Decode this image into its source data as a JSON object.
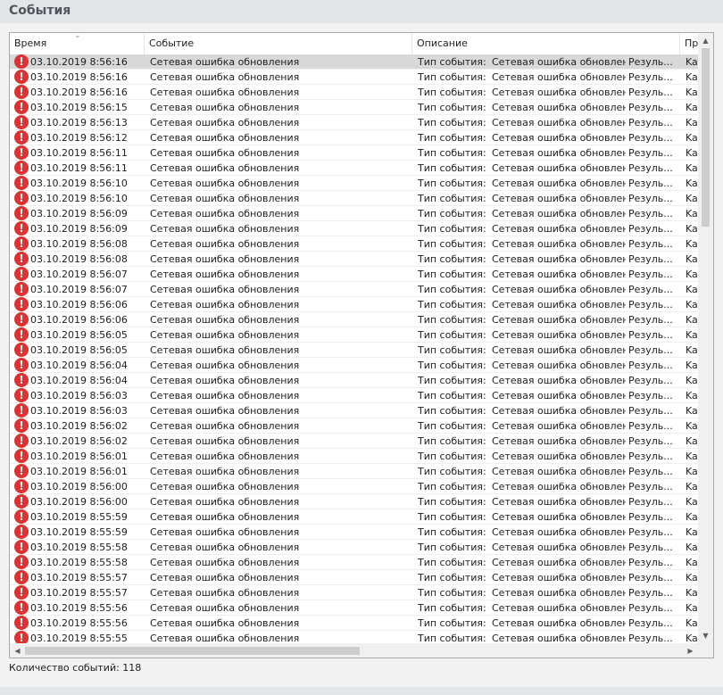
{
  "header": {
    "title": "События"
  },
  "list": {
    "columns": [
      {
        "id": "time",
        "label": "Время"
      },
      {
        "id": "event",
        "label": "Событие"
      },
      {
        "id": "description",
        "label": "Описание"
      },
      {
        "id": "product",
        "label": "Про"
      }
    ],
    "sort_icon": "sort-descending-icon",
    "row_icon": "error-icon",
    "row_icon_color": "#dc3232",
    "selected_row": 0,
    "rows": [
      {
        "time": "03.10.2019 8:56:16",
        "event": "Сетевая ошибка обновления",
        "type_label": "Тип события:",
        "type_value": "Сетевая ошибка обновления",
        "result": "Резуль...",
        "product": "Kas"
      },
      {
        "time": "03.10.2019 8:56:16",
        "event": "Сетевая ошибка обновления",
        "type_label": "Тип события:",
        "type_value": "Сетевая ошибка обновления",
        "result": "Резуль...",
        "product": "Kas"
      },
      {
        "time": "03.10.2019 8:56:16",
        "event": "Сетевая ошибка обновления",
        "type_label": "Тип события:",
        "type_value": "Сетевая ошибка обновления",
        "result": "Резуль...",
        "product": "Kas"
      },
      {
        "time": "03.10.2019 8:56:15",
        "event": "Сетевая ошибка обновления",
        "type_label": "Тип события:",
        "type_value": "Сетевая ошибка обновления",
        "result": "Резуль...",
        "product": "Kas"
      },
      {
        "time": "03.10.2019 8:56:13",
        "event": "Сетевая ошибка обновления",
        "type_label": "Тип события:",
        "type_value": "Сетевая ошибка обновления",
        "result": "Резуль...",
        "product": "Kas"
      },
      {
        "time": "03.10.2019 8:56:12",
        "event": "Сетевая ошибка обновления",
        "type_label": "Тип события:",
        "type_value": "Сетевая ошибка обновления",
        "result": "Резуль...",
        "product": "Kas"
      },
      {
        "time": "03.10.2019 8:56:11",
        "event": "Сетевая ошибка обновления",
        "type_label": "Тип события:",
        "type_value": "Сетевая ошибка обновления",
        "result": "Резуль...",
        "product": "Kas"
      },
      {
        "time": "03.10.2019 8:56:11",
        "event": "Сетевая ошибка обновления",
        "type_label": "Тип события:",
        "type_value": "Сетевая ошибка обновления",
        "result": "Резуль...",
        "product": "Kas"
      },
      {
        "time": "03.10.2019 8:56:10",
        "event": "Сетевая ошибка обновления",
        "type_label": "Тип события:",
        "type_value": "Сетевая ошибка обновления",
        "result": "Резуль...",
        "product": "Kas"
      },
      {
        "time": "03.10.2019 8:56:10",
        "event": "Сетевая ошибка обновления",
        "type_label": "Тип события:",
        "type_value": "Сетевая ошибка обновления",
        "result": "Резуль...",
        "product": "Kas"
      },
      {
        "time": "03.10.2019 8:56:09",
        "event": "Сетевая ошибка обновления",
        "type_label": "Тип события:",
        "type_value": "Сетевая ошибка обновления",
        "result": "Резуль...",
        "product": "Kas"
      },
      {
        "time": "03.10.2019 8:56:09",
        "event": "Сетевая ошибка обновления",
        "type_label": "Тип события:",
        "type_value": "Сетевая ошибка обновления",
        "result": "Резуль...",
        "product": "Kas"
      },
      {
        "time": "03.10.2019 8:56:08",
        "event": "Сетевая ошибка обновления",
        "type_label": "Тип события:",
        "type_value": "Сетевая ошибка обновления",
        "result": "Резуль...",
        "product": "Kas"
      },
      {
        "time": "03.10.2019 8:56:08",
        "event": "Сетевая ошибка обновления",
        "type_label": "Тип события:",
        "type_value": "Сетевая ошибка обновления",
        "result": "Резуль...",
        "product": "Kas"
      },
      {
        "time": "03.10.2019 8:56:07",
        "event": "Сетевая ошибка обновления",
        "type_label": "Тип события:",
        "type_value": "Сетевая ошибка обновления",
        "result": "Резуль...",
        "product": "Kas"
      },
      {
        "time": "03.10.2019 8:56:07",
        "event": "Сетевая ошибка обновления",
        "type_label": "Тип события:",
        "type_value": "Сетевая ошибка обновления",
        "result": "Резуль...",
        "product": "Kas"
      },
      {
        "time": "03.10.2019 8:56:06",
        "event": "Сетевая ошибка обновления",
        "type_label": "Тип события:",
        "type_value": "Сетевая ошибка обновления",
        "result": "Резуль...",
        "product": "Kas"
      },
      {
        "time": "03.10.2019 8:56:06",
        "event": "Сетевая ошибка обновления",
        "type_label": "Тип события:",
        "type_value": "Сетевая ошибка обновления",
        "result": "Резуль...",
        "product": "Kas"
      },
      {
        "time": "03.10.2019 8:56:05",
        "event": "Сетевая ошибка обновления",
        "type_label": "Тип события:",
        "type_value": "Сетевая ошибка обновления",
        "result": "Резуль...",
        "product": "Kas"
      },
      {
        "time": "03.10.2019 8:56:05",
        "event": "Сетевая ошибка обновления",
        "type_label": "Тип события:",
        "type_value": "Сетевая ошибка обновления",
        "result": "Резуль...",
        "product": "Kas"
      },
      {
        "time": "03.10.2019 8:56:04",
        "event": "Сетевая ошибка обновления",
        "type_label": "Тип события:",
        "type_value": "Сетевая ошибка обновления",
        "result": "Резуль...",
        "product": "Kas"
      },
      {
        "time": "03.10.2019 8:56:04",
        "event": "Сетевая ошибка обновления",
        "type_label": "Тип события:",
        "type_value": "Сетевая ошибка обновления",
        "result": "Резуль...",
        "product": "Kas"
      },
      {
        "time": "03.10.2019 8:56:03",
        "event": "Сетевая ошибка обновления",
        "type_label": "Тип события:",
        "type_value": "Сетевая ошибка обновления",
        "result": "Резуль...",
        "product": "Kas"
      },
      {
        "time": "03.10.2019 8:56:03",
        "event": "Сетевая ошибка обновления",
        "type_label": "Тип события:",
        "type_value": "Сетевая ошибка обновления",
        "result": "Резуль...",
        "product": "Kas"
      },
      {
        "time": "03.10.2019 8:56:02",
        "event": "Сетевая ошибка обновления",
        "type_label": "Тип события:",
        "type_value": "Сетевая ошибка обновления",
        "result": "Резуль...",
        "product": "Kas"
      },
      {
        "time": "03.10.2019 8:56:02",
        "event": "Сетевая ошибка обновления",
        "type_label": "Тип события:",
        "type_value": "Сетевая ошибка обновления",
        "result": "Резуль...",
        "product": "Kas"
      },
      {
        "time": "03.10.2019 8:56:01",
        "event": "Сетевая ошибка обновления",
        "type_label": "Тип события:",
        "type_value": "Сетевая ошибка обновления",
        "result": "Резуль...",
        "product": "Kas"
      },
      {
        "time": "03.10.2019 8:56:01",
        "event": "Сетевая ошибка обновления",
        "type_label": "Тип события:",
        "type_value": "Сетевая ошибка обновления",
        "result": "Резуль...",
        "product": "Kas"
      },
      {
        "time": "03.10.2019 8:56:00",
        "event": "Сетевая ошибка обновления",
        "type_label": "Тип события:",
        "type_value": "Сетевая ошибка обновления",
        "result": "Резуль...",
        "product": "Kas"
      },
      {
        "time": "03.10.2019 8:56:00",
        "event": "Сетевая ошибка обновления",
        "type_label": "Тип события:",
        "type_value": "Сетевая ошибка обновления",
        "result": "Резуль...",
        "product": "Kas"
      },
      {
        "time": "03.10.2019 8:55:59",
        "event": "Сетевая ошибка обновления",
        "type_label": "Тип события:",
        "type_value": "Сетевая ошибка обновления",
        "result": "Резуль...",
        "product": "Kas"
      },
      {
        "time": "03.10.2019 8:55:59",
        "event": "Сетевая ошибка обновления",
        "type_label": "Тип события:",
        "type_value": "Сетевая ошибка обновления",
        "result": "Резуль...",
        "product": "Kas"
      },
      {
        "time": "03.10.2019 8:55:58",
        "event": "Сетевая ошибка обновления",
        "type_label": "Тип события:",
        "type_value": "Сетевая ошибка обновления",
        "result": "Резуль...",
        "product": "Kas"
      },
      {
        "time": "03.10.2019 8:55:58",
        "event": "Сетевая ошибка обновления",
        "type_label": "Тип события:",
        "type_value": "Сетевая ошибка обновления",
        "result": "Резуль...",
        "product": "Kas"
      },
      {
        "time": "03.10.2019 8:55:57",
        "event": "Сетевая ошибка обновления",
        "type_label": "Тип события:",
        "type_value": "Сетевая ошибка обновления",
        "result": "Резуль...",
        "product": "Kas"
      },
      {
        "time": "03.10.2019 8:55:57",
        "event": "Сетевая ошибка обновления",
        "type_label": "Тип события:",
        "type_value": "Сетевая ошибка обновления",
        "result": "Резуль...",
        "product": "Kas"
      },
      {
        "time": "03.10.2019 8:55:56",
        "event": "Сетевая ошибка обновления",
        "type_label": "Тип события:",
        "type_value": "Сетевая ошибка обновления",
        "result": "Резуль...",
        "product": "Kas"
      },
      {
        "time": "03.10.2019 8:55:56",
        "event": "Сетевая ошибка обновления",
        "type_label": "Тип события:",
        "type_value": "Сетевая ошибка обновления",
        "result": "Резуль...",
        "product": "Kas"
      },
      {
        "time": "03.10.2019 8:55:55",
        "event": "Сетевая ошибка обновления",
        "type_label": "Тип события:",
        "type_value": "Сетевая ошибка обновления",
        "result": "Резуль...",
        "product": "Kas"
      }
    ]
  },
  "status": {
    "count_text": "Количество событий: 118"
  }
}
